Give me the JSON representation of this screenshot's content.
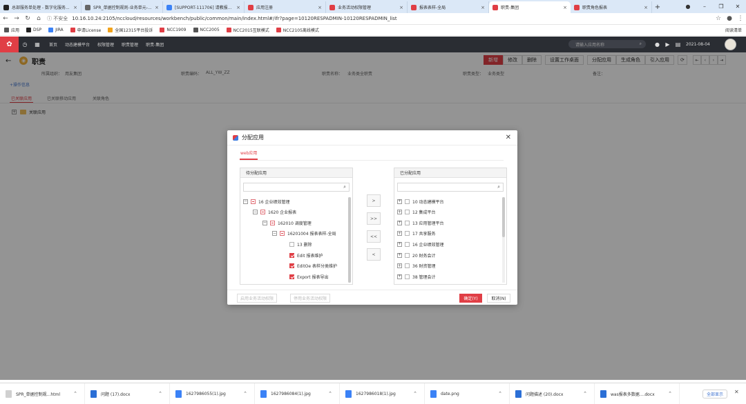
{
  "browser": {
    "tabs": [
      {
        "label": "总部服务单处理 - 数字化服务...",
        "color": "#222222",
        "active": false
      },
      {
        "label": "SPR_单据控制规则-业务单元-...",
        "color": "#666666",
        "active": false
      },
      {
        "label": "[SUPPORT-111706] 请教报...",
        "color": "#3b82f6",
        "active": false
      },
      {
        "label": "应用注册",
        "color": "#e03e45",
        "active": false
      },
      {
        "label": "业务活动权限管理",
        "color": "#e03e45",
        "active": false
      },
      {
        "label": "报表表样-全局",
        "color": "#e03e45",
        "active": false
      },
      {
        "label": "职责-集团",
        "color": "#e03e45",
        "active": true
      },
      {
        "label": "职责角色报表",
        "color": "#e03e45",
        "active": false
      }
    ],
    "new_tab": "+",
    "window_controls": {
      "minimize": "–",
      "restore": "❐",
      "close": "✕",
      "profile": "●"
    },
    "insecure_label": "ⓘ 不安全",
    "url": "10.16.10.24:2105/nccloud/resources/workbench/public/common/main/index.html#/ifr?page=10120RESPADMIN-10120RESPADMIN_list",
    "bookmarks": [
      {
        "label": "应用",
        "color": "#555555"
      },
      {
        "label": "DSP",
        "color": "#222222"
      },
      {
        "label": "JIRA",
        "color": "#3b82f6"
      },
      {
        "label": "申请License",
        "color": "#e03e45"
      },
      {
        "label": "全国12315平台投诉",
        "color": "#f2a31b"
      },
      {
        "label": "NCC1909",
        "color": "#e03e45"
      },
      {
        "label": "NCC2005",
        "color": "#555555"
      },
      {
        "label": "NCC2015互联模式",
        "color": "#e03e45"
      },
      {
        "label": "NCC2105离线模式",
        "color": "#e03e45"
      }
    ],
    "reading_list": "阅读清单"
  },
  "app_header": {
    "breadcrumbs": [
      "首页",
      "动态建模平台",
      "权限管理",
      "职责管理",
      "职责-集团"
    ],
    "search_placeholder": "请输入应用名称",
    "date": "2021-08-04"
  },
  "page": {
    "title": "职责",
    "buttons": [
      "新增",
      "修改",
      "删除",
      "设置工作桌面",
      "分配应用",
      "生成角色",
      "引入应用"
    ],
    "info_fields": [
      {
        "label": "所属组织：",
        "value": "用友集团"
      },
      {
        "label": "职责编码：",
        "value": "ALL_YW_ZZ"
      },
      {
        "label": "职责名称：",
        "value": "业务类全职责"
      },
      {
        "label": "职责类型：",
        "value": "业务类型"
      },
      {
        "label": "备注：",
        "value": ""
      }
    ],
    "op_info": "+操作信息",
    "subtabs": [
      "已关联应用",
      "已关联移动应用",
      "关联角色"
    ],
    "tree_root": "关联应用"
  },
  "modal": {
    "title": "分配应用",
    "tab": "web应用",
    "left_panel": {
      "title": "待分配应用",
      "rows": [
        {
          "label": "16 企业绩效管理",
          "level": 0,
          "toggle": "−",
          "check": "half"
        },
        {
          "label": "1620 企业报表",
          "level": 1,
          "toggle": "−",
          "check": "half"
        },
        {
          "label": "162010 调度管理",
          "level": 2,
          "toggle": "−",
          "check": "half"
        },
        {
          "label": "16201004 报表表样-全局",
          "level": 3,
          "toggle": "−",
          "check": "half"
        },
        {
          "label": "13 删除",
          "level": 4,
          "toggle": "",
          "check": "off"
        },
        {
          "label": "Edit 报表维护",
          "level": 4,
          "toggle": "",
          "check": "on"
        },
        {
          "label": "EditOe 表样分类维护",
          "level": 4,
          "toggle": "",
          "check": "on"
        },
        {
          "label": "Export 报表导出",
          "level": 4,
          "toggle": "",
          "check": "on"
        }
      ]
    },
    "right_panel": {
      "title": "已分配应用",
      "rows": [
        {
          "label": "10 动态建模平台",
          "level": 0,
          "toggle": "+",
          "check": "off"
        },
        {
          "label": "12 集成平台",
          "level": 0,
          "toggle": "+",
          "check": "off"
        },
        {
          "label": "13 应用管理平台",
          "level": 0,
          "toggle": "+",
          "check": "off"
        },
        {
          "label": "17 共享服务",
          "level": 0,
          "toggle": "+",
          "check": "off"
        },
        {
          "label": "16 企业绩效管理",
          "level": 0,
          "toggle": "+",
          "check": "off"
        },
        {
          "label": "20 财务会计",
          "level": 0,
          "toggle": "+",
          "check": "off"
        },
        {
          "label": "36 财资管理",
          "level": 0,
          "toggle": "+",
          "check": "off"
        },
        {
          "label": "38 管理会计",
          "level": 0,
          "toggle": "+",
          "check": "off"
        }
      ]
    },
    "move_buttons": [
      ">",
      ">>",
      "<<",
      "<"
    ],
    "footer": {
      "enable_label": "启用业务活动权限",
      "disable_label": "停用业务活动权限",
      "confirm_label": "确定(Y)",
      "cancel_label": "取消(N)"
    }
  },
  "downloads": {
    "items": [
      {
        "name": "SPR_单据控制规...html",
        "color": "#d0d0d0"
      },
      {
        "name": "问题 (17).docx",
        "color": "#2b6fd6"
      },
      {
        "name": "1627986055(1).jpg",
        "color": "#3b82f6"
      },
      {
        "name": "1627986084(1).jpg",
        "color": "#3b82f6"
      },
      {
        "name": "1627986018(1).jpg",
        "color": "#3b82f6"
      },
      {
        "name": "date.png",
        "color": "#3b82f6"
      },
      {
        "name": "问题描述 (20).docx",
        "color": "#2b6fd6"
      },
      {
        "name": "was报表多数据....docx",
        "color": "#2b6fd6"
      }
    ],
    "show_all": "全部显示"
  }
}
